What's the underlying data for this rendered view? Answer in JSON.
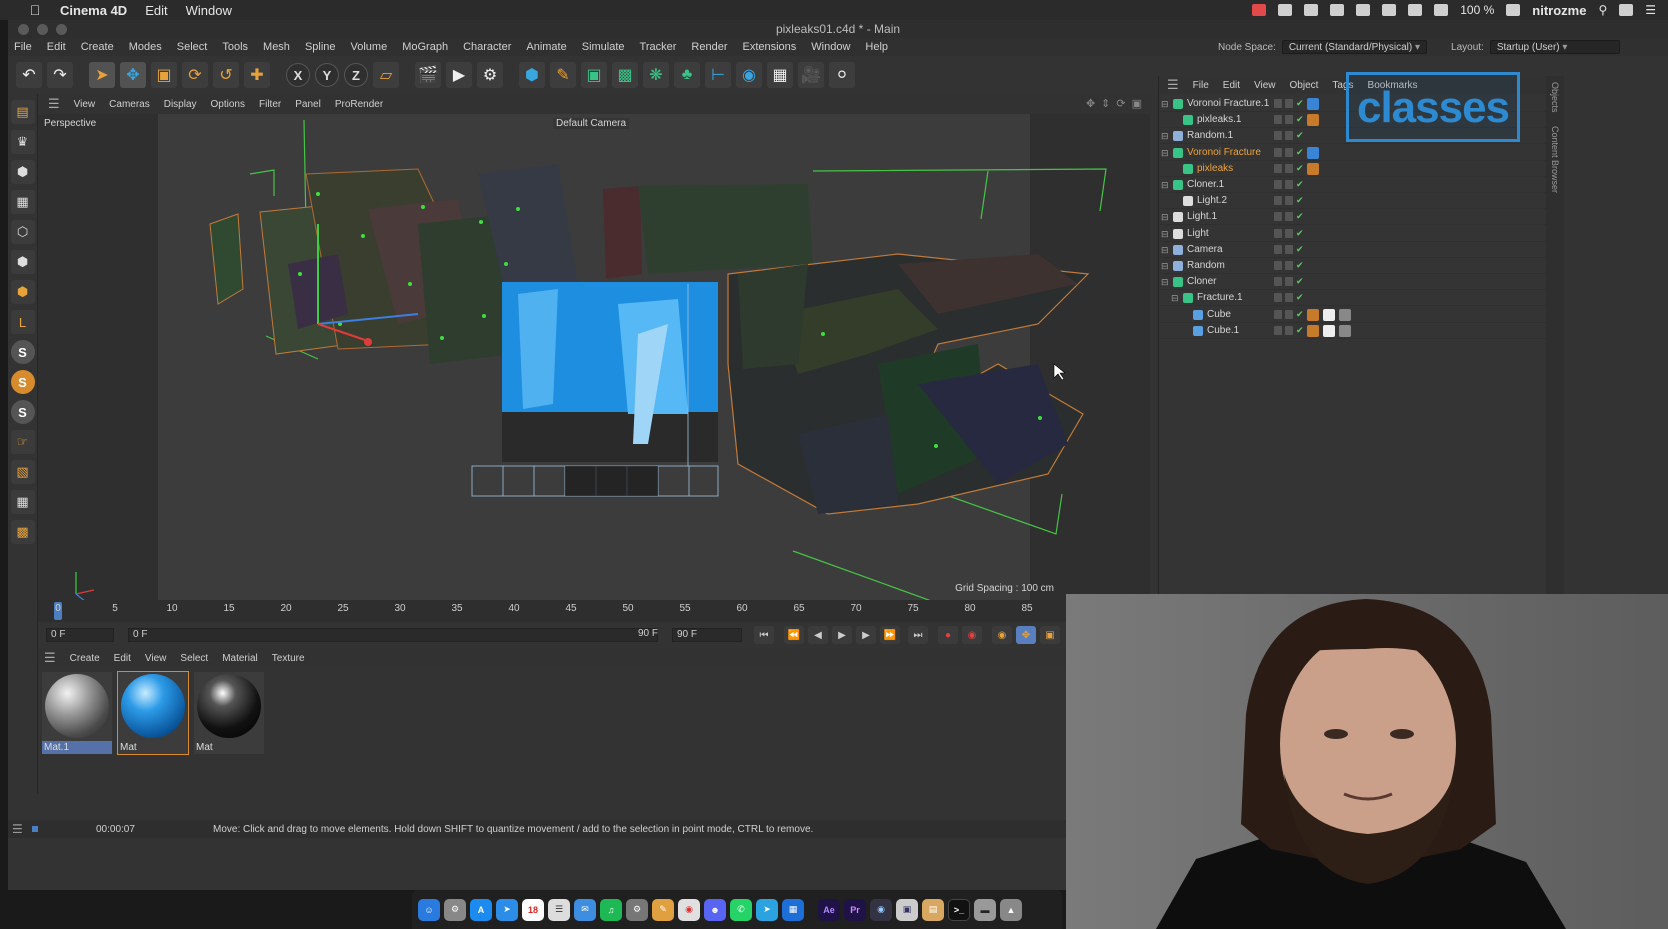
{
  "mac_menubar": {
    "app_name": "Cinema 4D",
    "menus": [
      "Edit",
      "Window"
    ],
    "battery": "100 %",
    "user": "nitrozme"
  },
  "window": {
    "title": "pixleaks01.c4d * - Main"
  },
  "menu": [
    "File",
    "Edit",
    "Create",
    "Modes",
    "Select",
    "Tools",
    "Mesh",
    "Spline",
    "Volume",
    "MoGraph",
    "Character",
    "Animate",
    "Simulate",
    "Tracker",
    "Render",
    "Extensions",
    "Window",
    "Help"
  ],
  "node_space": {
    "label": "Node Space:",
    "value": "Current (Standard/Physical)"
  },
  "layout": {
    "label": "Layout:",
    "value": "Startup (User)"
  },
  "viewport": {
    "menu": [
      "View",
      "Cameras",
      "Display",
      "Options",
      "Filter",
      "Panel",
      "ProRender"
    ],
    "label": "Perspective",
    "camera": "Default Camera",
    "grid_spacing": "Grid Spacing : 100 cm"
  },
  "timeline": {
    "ticks": [
      "0",
      "5",
      "10",
      "15",
      "20",
      "25",
      "30",
      "35",
      "40",
      "45",
      "50",
      "55",
      "60",
      "65",
      "70",
      "75",
      "80",
      "85"
    ],
    "current_frame": "0 F",
    "start_frame": "0 F",
    "end_frame": "90 F",
    "max_frame": "90 F"
  },
  "materials": {
    "menu": [
      "Create",
      "Edit",
      "View",
      "Select",
      "Material",
      "Texture"
    ],
    "items": [
      {
        "name": "Mat.1",
        "selected": true
      },
      {
        "name": "Mat",
        "selected": false
      },
      {
        "name": "Mat",
        "selected": false
      }
    ]
  },
  "status": {
    "time": "00:00:07",
    "message": "Move: Click and drag to move elements. Hold down SHIFT to quantize movement / add to the selection in point mode, CTRL to remove."
  },
  "objects": {
    "menu": [
      "File",
      "Edit",
      "View",
      "Object",
      "Tags",
      "Bookmarks"
    ],
    "rows": [
      {
        "name": "Voronoi Fracture.1",
        "depth": 0,
        "active": false,
        "icon": "voronoi-icon"
      },
      {
        "name": "pixleaks.1",
        "depth": 1,
        "active": false,
        "icon": "text-icon"
      },
      {
        "name": "Random.1",
        "depth": 0,
        "active": false,
        "icon": "random-effector-icon"
      },
      {
        "name": "Voronoi Fracture",
        "depth": 0,
        "active": true,
        "icon": "voronoi-icon"
      },
      {
        "name": "pixleaks",
        "depth": 1,
        "active": true,
        "icon": "text-icon"
      },
      {
        "name": "Cloner.1",
        "depth": 0,
        "active": false,
        "icon": "cloner-icon"
      },
      {
        "name": "Light.2",
        "depth": 1,
        "active": false,
        "icon": "light-icon"
      },
      {
        "name": "Light.1",
        "depth": 0,
        "active": false,
        "icon": "light-icon"
      },
      {
        "name": "Light",
        "depth": 0,
        "active": false,
        "icon": "light-icon"
      },
      {
        "name": "Camera",
        "depth": 0,
        "active": false,
        "icon": "camera-icon"
      },
      {
        "name": "Random",
        "depth": 0,
        "active": false,
        "icon": "random-effector-icon"
      },
      {
        "name": "Cloner",
        "depth": 0,
        "active": false,
        "icon": "cloner-icon"
      },
      {
        "name": "Fracture.1",
        "depth": 1,
        "active": false,
        "icon": "fracture-icon"
      },
      {
        "name": "Cube",
        "depth": 2,
        "active": false,
        "icon": "cube-icon"
      },
      {
        "name": "Cube.1",
        "depth": 2,
        "active": false,
        "icon": "cube-icon"
      }
    ]
  },
  "right_strip": [
    "Objects",
    "Content Browser"
  ],
  "overlay": {
    "watermark": "classes"
  },
  "dock": {
    "apps": [
      "finder",
      "launchpad",
      "app-store",
      "safari",
      "calendar",
      "notes",
      "mail",
      "spotify",
      "system-preferences",
      "brush",
      "chrome",
      "discord",
      "whatsapp",
      "telegram",
      "flashcards",
      "after-effects",
      "premiere",
      "cinema4d",
      "preview",
      "archive",
      "terminal",
      "disk",
      "trash"
    ],
    "labels": {
      "after-effects": "Ae",
      "premiere": "Pr",
      "calendar": "18"
    }
  }
}
